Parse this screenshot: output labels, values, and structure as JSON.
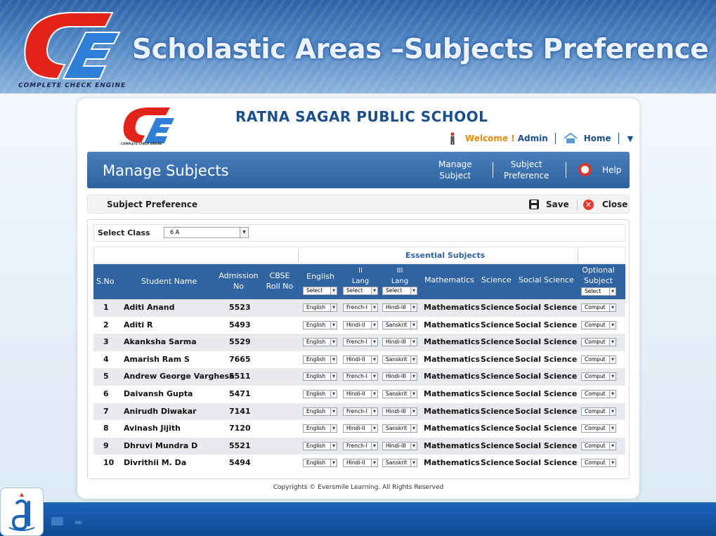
{
  "slide": {
    "title": "Scholastic Areas –Subjects Preference",
    "logo_text": "COMPLETE CHECK ENGINE"
  },
  "app": {
    "school_name": "RATNA SAGAR PUBLIC SCHOOL",
    "logo_text": "COMPLETE CHECK ENGINE",
    "welcome": "Welcome !",
    "user": "Admin",
    "home": "Home",
    "module_title": "Manage Subjects",
    "nav": {
      "manage_subject": [
        "Manage",
        "Subject"
      ],
      "subject_preference": [
        "Subject",
        "Preference"
      ],
      "help": "Help"
    },
    "toolbar": {
      "title": "Subject Preference",
      "save": "Save",
      "close": "Close"
    },
    "select_class": {
      "label": "Select Class",
      "value": "6 A"
    },
    "essential_subjects": "Essential Subjects",
    "columns": {
      "sno": "S.No",
      "student_name": "Student Name",
      "admission_no": [
        "Admission",
        "No"
      ],
      "cbse_roll_no": [
        "CBSE",
        "Roll No"
      ],
      "english": "English",
      "ii_lang": [
        "II",
        "Lang"
      ],
      "iii_lang": [
        "III",
        "Lang"
      ],
      "mathematics": "Mathematics",
      "science": "Science",
      "social_science": "Social Science",
      "optional_subject": [
        "Optional",
        "Subject"
      ],
      "select": "Select"
    },
    "rows": [
      {
        "sno": "1",
        "name": "Aditi Anand",
        "adm": "5523",
        "eng": "English",
        "ii": "French-I",
        "iii": "Hindi-III",
        "math": "Mathematics",
        "sci": "Science",
        "soc": "Social Science",
        "opt": "Comput"
      },
      {
        "sno": "2",
        "name": "Aditi R",
        "adm": "5493",
        "eng": "English",
        "ii": "Hindi-II",
        "iii": "Sanskrit",
        "math": "Mathematics",
        "sci": "Science",
        "soc": "Social Science",
        "opt": "Comput"
      },
      {
        "sno": "3",
        "name": "Akanksha Sarma",
        "adm": "5529",
        "eng": "English",
        "ii": "French-I",
        "iii": "Hindi-III",
        "math": "Mathematics",
        "sci": "Science",
        "soc": "Social Science",
        "opt": "Comput"
      },
      {
        "sno": "4",
        "name": "Amarish Ram S",
        "adm": "7665",
        "eng": "English",
        "ii": "Hindi-II",
        "iii": "Sanskrit",
        "math": "Mathematics",
        "sci": "Science",
        "soc": "Social Science",
        "opt": "Comput"
      },
      {
        "sno": "5",
        "name": "Andrew George Varghese",
        "adm": "5511",
        "eng": "English",
        "ii": "French-I",
        "iii": "Hindi-III",
        "math": "Mathematics",
        "sci": "Science",
        "soc": "Social Science",
        "opt": "Comput"
      },
      {
        "sno": "6",
        "name": "Daivansh Gupta",
        "adm": "5471",
        "eng": "English",
        "ii": "Hindi-II",
        "iii": "Sanskrit",
        "math": "Mathematics",
        "sci": "Science",
        "soc": "Social Science",
        "opt": "Comput"
      },
      {
        "sno": "7",
        "name": "Anirudh Diwakar",
        "adm": "7141",
        "eng": "English",
        "ii": "French-I",
        "iii": "Hindi-III",
        "math": "Mathematics",
        "sci": "Science",
        "soc": "Social Science",
        "opt": "Comput"
      },
      {
        "sno": "8",
        "name": "Avinash Jijith",
        "adm": "7120",
        "eng": "English",
        "ii": "Hindi-II",
        "iii": "Sanskrit",
        "math": "Mathematics",
        "sci": "Science",
        "soc": "Social Science",
        "opt": "Comput"
      },
      {
        "sno": "9",
        "name": "Dhruvi Mundra D",
        "adm": "5521",
        "eng": "English",
        "ii": "French-I",
        "iii": "Hindi-III",
        "math": "Mathematics",
        "sci": "Science",
        "soc": "Social Science",
        "opt": "Comput"
      },
      {
        "sno": "10",
        "name": "Divrithii M. Da",
        "adm": "5494",
        "eng": "English",
        "ii": "Hindi-II",
        "iii": "Sanskrit",
        "math": "Mathematics",
        "sci": "Science",
        "soc": "Social Science",
        "opt": "Comput"
      }
    ],
    "copyright": "Copyrights © Eversmile Learning. All Rights Reserved"
  },
  "colors": {
    "header_blue": "#2f63a2",
    "accent_orange": "#e28a0e",
    "logo_red": "#e2231a",
    "logo_blue": "#2f7fd6"
  }
}
